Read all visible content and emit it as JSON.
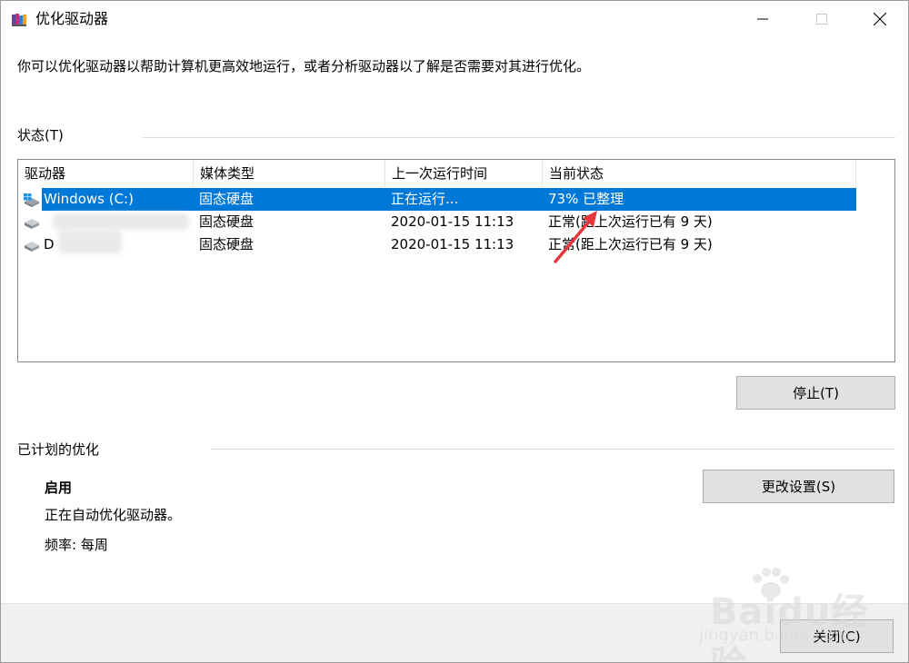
{
  "window": {
    "title": "优化驱动器"
  },
  "description": "你可以优化驱动器以帮助计算机更高效地运行，或者分析驱动器以了解是否需要对其进行优化。",
  "status_section": {
    "label": "状态(T)",
    "columns": [
      "驱动器",
      "媒体类型",
      "上一次运行时间",
      "当前状态"
    ],
    "rows": [
      {
        "drive": "Windows (C:)",
        "media": "固态硬盘",
        "last_run": "正在运行...",
        "status": "73% 已整理",
        "selected": true
      },
      {
        "drive": "",
        "media": "固态硬盘",
        "last_run": "2020-01-15 11:13",
        "status": "正常(距上次运行已有 9 天)",
        "selected": false
      },
      {
        "drive": "D",
        "media": "固态硬盘",
        "last_run": "2020-01-15 11:13",
        "status": "正常(距上次运行已有 9 天)",
        "selected": false
      }
    ],
    "stop_button": "停止(T)"
  },
  "scheduled_section": {
    "label": "已计划的优化",
    "state": "启用",
    "detail": "正在自动优化驱动器。",
    "frequency": "频率: 每周",
    "change_settings_button": "更改设置(S)"
  },
  "footer": {
    "close_button": "关闭(C)"
  },
  "watermark": {
    "text": "Baidu经验",
    "sub": "jingyan.baidu.com"
  },
  "colors": {
    "selection": "#0078d7",
    "button_bg": "#e1e1e1",
    "annotation_arrow": "#e8363d"
  }
}
